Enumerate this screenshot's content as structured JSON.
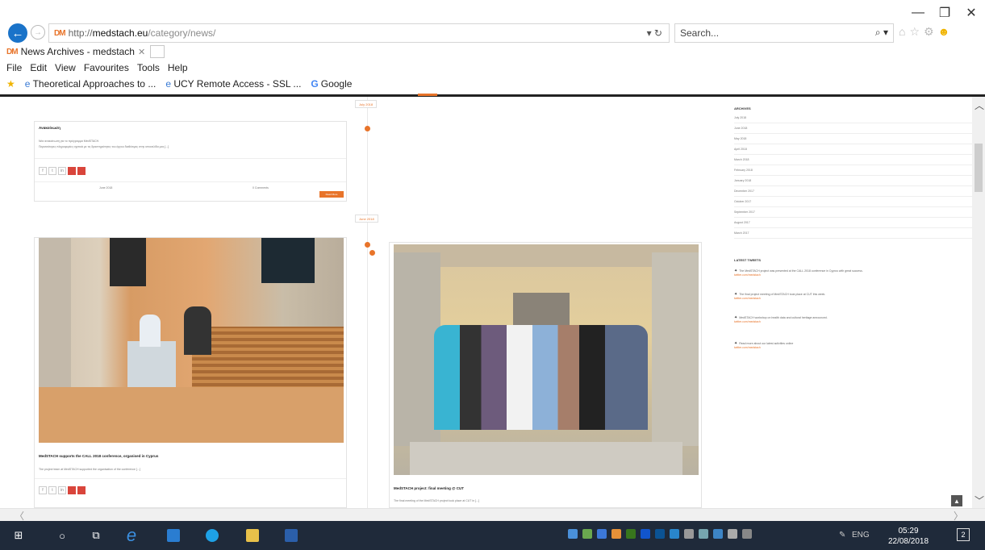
{
  "browser": {
    "url_prefix": "http://",
    "url_host": "medstach.eu",
    "url_path": "/category/news/",
    "search_placeholder": "Search...",
    "tab_title": "News Archives - medstach",
    "site_icon": "DM",
    "menu": [
      "File",
      "Edit",
      "View",
      "Favourites",
      "Tools",
      "Help"
    ],
    "favourites": [
      "Theoretical Approaches to ...",
      "UCY Remote Access - SSL ...",
      "Google"
    ],
    "window_controls": {
      "minimize": "—",
      "restore": "❐",
      "close": "✕"
    }
  },
  "page": {
    "posts": [
      {
        "title": "Ανακοίνωση",
        "excerpt_line1": "Νέα ανακοίνωση για το πρόγραμμα MedSTACH.",
        "excerpt_line2": "Περισσότερες πληροφορίες σχετικά με τις δραστηριότητες του έργου διαθέσιμες στην ιστοσελίδα μας [...]",
        "meta_left": "June 2018",
        "meta_right": "0 Comments",
        "read_more": "Read More"
      },
      {
        "title": "MedSTACH supports the CALL 2018 conference, organised in Cyprus",
        "excerpt": "The project team at MedSTACH supported the organisation of the conference [...]"
      },
      {
        "title": "MedSTACH project: final meeting @ CUT",
        "excerpt": "The final meeting of the MedSTACH project took place at CUT in [...]"
      }
    ],
    "timeline_labels": [
      "July 2018",
      "June 2018"
    ],
    "sidebar": {
      "archives_heading": "ARCHIVES",
      "archives": [
        "July 2018",
        "June 2018",
        "May 2018",
        "April 2018",
        "March 2018",
        "February 2018",
        "January 2018",
        "December 2017",
        "October 2017",
        "September 2017",
        "August 2017",
        "March 2017"
      ],
      "tweets_heading": "LATEST TWEETS",
      "tweets": [
        {
          "text": "The MedSTACH project was presented at the CALL 2018 conference in Cyprus with great success.",
          "link": "twitter.com/medstach"
        },
        {
          "text": "The final project meeting of MedSTACH took place at CUT this week.",
          "link": "twitter.com/medstach"
        },
        {
          "text": "MedSTACH workshop on health data and cultural heritage announced.",
          "link": "twitter.com/medstach"
        },
        {
          "text": "Read more about our latest activities online",
          "link": "twitter.com/medstach"
        }
      ]
    }
  },
  "taskbar": {
    "language": "ENG",
    "time": "05:29",
    "date": "22/08/2018",
    "notifications": "2"
  }
}
